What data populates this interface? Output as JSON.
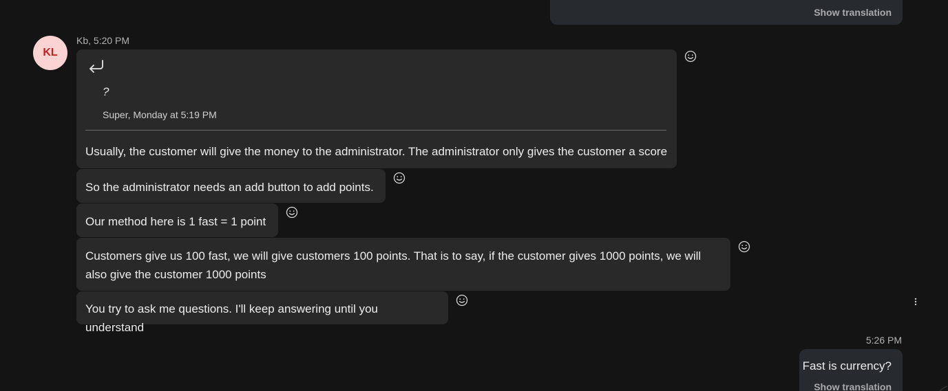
{
  "colors": {
    "background": "#141414",
    "incoming_bubble": "#292929",
    "outgoing_bubble": "#272a2f",
    "avatar_bg": "#fbd3d3",
    "avatar_text": "#c61f1f"
  },
  "previous_message": {
    "show_translation": "Show translation"
  },
  "thread": {
    "avatar_initials": "KL",
    "sender_meta": "Kb, 5:20 PM",
    "reply": {
      "icon": "reply-arrow-icon",
      "quoted_text": "?",
      "quoted_meta": "Super, Monday at 5:19 PM",
      "text": "Usually, the customer will give the money to the administrator. The administrator only gives the customer a score"
    },
    "messages": [
      {
        "text": "So the administrator needs an add button to add points."
      },
      {
        "text": "Our method here is 1 fast = 1 point"
      },
      {
        "text": "Customers give us 100 fast, we will give customers 100 points. That is to say, if the customer gives 1000 points, we will also give the customer 1000 points"
      },
      {
        "text": "You try to ask me questions. I'll keep answering until you understand"
      }
    ],
    "reaction_icon": "smiley-icon",
    "more_icon": "more-vertical-icon"
  },
  "my_message": {
    "time": "5:26 PM",
    "text": "Fast is currency?",
    "show_translation": "Show translation"
  }
}
